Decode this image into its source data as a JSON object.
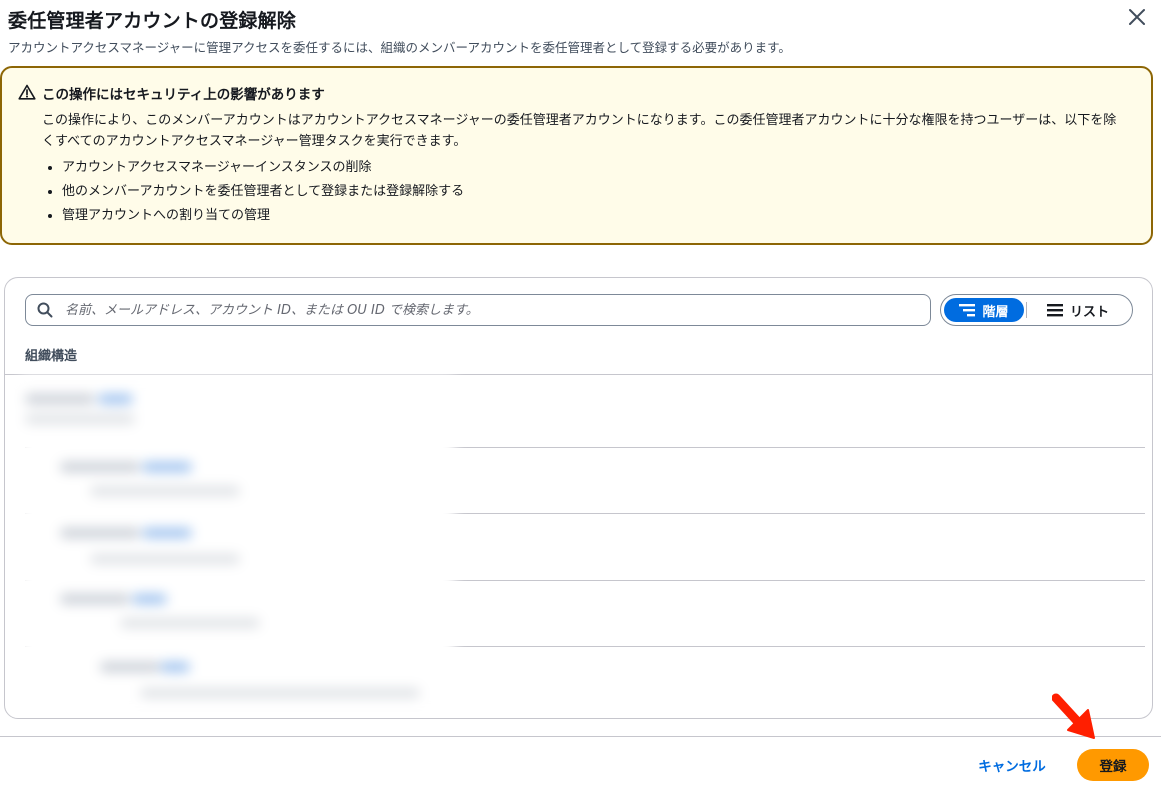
{
  "modal": {
    "title": "委任管理者アカウントの登録解除",
    "subtitle": "アカウントアクセスマネージャーに管理アクセスを委任するには、組織のメンバーアカウントを委任管理者として登録する必要があります。"
  },
  "alert": {
    "icon": "warning-triangle-icon",
    "heading": "この操作にはセキュリティ上の影響があります",
    "body": "この操作により、このメンバーアカウントはアカウントアクセスマネージャーの委任管理者アカウントになります。この委任管理者アカウントに十分な権限を持つユーザーは、以下を除くすべてのアカウントアクセスマネージャー管理タスクを実行できます。",
    "items": [
      "アカウントアクセスマネージャーインスタンスの削除",
      "他のメンバーアカウントを委任管理者として登録または登録解除する",
      "管理アカウントへの割り当ての管理"
    ],
    "border_color": "#8d6605",
    "background_color": "#fffce9"
  },
  "search": {
    "placeholder": "名前、メールアドレス、アカウント ID、または OU ID で検索します。",
    "value": ""
  },
  "view_toggle": {
    "hierarchy_label": "階層",
    "list_label": "リスト",
    "selected": "hierarchy"
  },
  "table": {
    "column_header": "組織構造"
  },
  "footer": {
    "cancel_label": "キャンセル",
    "register_label": "登録"
  },
  "colors": {
    "primary_blue": "#006ce0",
    "primary_button": "#ff9900",
    "annotation_arrow": "#ff1f00"
  }
}
